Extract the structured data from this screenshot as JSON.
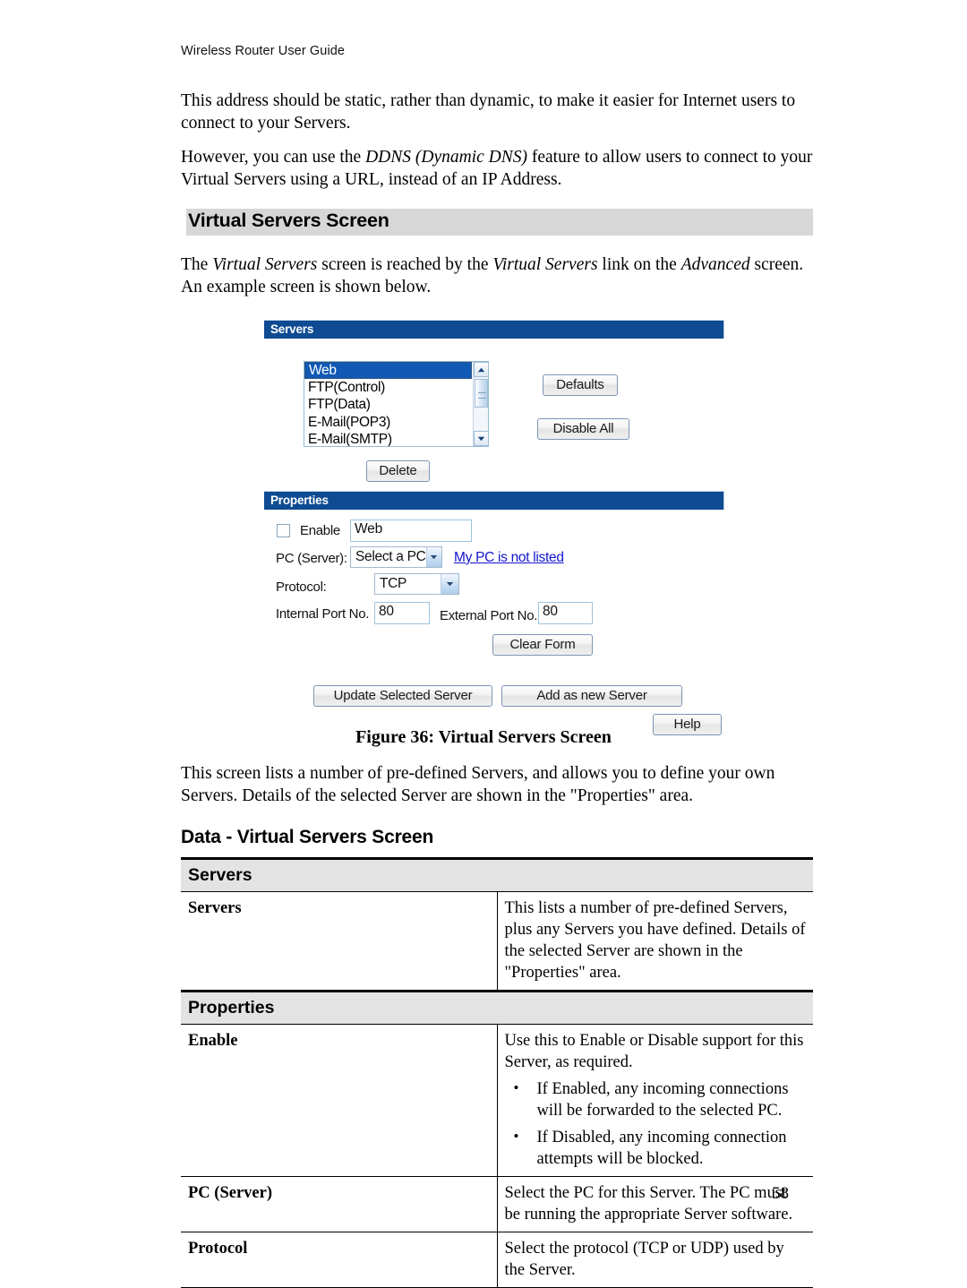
{
  "document": {
    "running_header": "Wireless Router User Guide",
    "page_number": "58"
  },
  "intro": {
    "para1": "This address should be static, rather than dynamic, to make it easier for Internet users to connect to your Servers.",
    "para2_a": "However, you can use the ",
    "para2_em": "DDNS (Dynamic DNS)",
    "para2_b": " feature to allow users to connect to your Virtual Servers using a URL, instead of an IP Address."
  },
  "section_heading": "Virtual Servers Screen",
  "section_intro": {
    "a": "The ",
    "em1": "Virtual Servers",
    "b": " screen is reached by the ",
    "em2": "Virtual Servers",
    "c": " link on the ",
    "em3": "Advanced",
    "d": " screen. An example screen is shown below."
  },
  "figure": {
    "servers_bar": "Servers",
    "server_list": [
      "Web",
      "FTP(Control)",
      "FTP(Data)",
      "E-Mail(POP3)",
      "E-Mail(SMTP)"
    ],
    "selected_server": "Web",
    "defaults_button": "Defaults",
    "disable_all_button": "Disable All",
    "delete_button": "Delete",
    "properties_bar": "Properties",
    "enable_label": "Enable",
    "enable_value": "Web",
    "pc_server_label": "PC (Server):",
    "pc_server_value": "Select a PC",
    "pc_not_listed_link": "My PC is not listed",
    "protocol_label": "Protocol:",
    "protocol_value": "TCP",
    "internal_port_label": "Internal Port No.",
    "internal_port_value": "80",
    "external_port_label": "External Port No.",
    "external_port_value": "80",
    "clear_form_button": "Clear Form",
    "update_button": "Update Selected Server",
    "add_button": "Add as new Server",
    "help_button": "Help",
    "caption": "Figure 36: Virtual Servers Screen",
    "colors": {
      "title_bar": "#0e4b92",
      "selection": "#1059b5",
      "link": "#1414ce"
    }
  },
  "post_figure_text": "This screen lists a number of pre-defined Servers, and allows you to define your own Servers. Details of the selected Server are shown in the \"Properties\" area.",
  "data_table": {
    "title": "Data - Virtual Servers Screen",
    "sections": [
      {
        "header": "Servers",
        "rows": [
          {
            "key": "Servers",
            "value": "This lists a number of pre-defined Servers, plus any Servers you have defined. Details of the selected Server are shown in the \"Properties\" area.",
            "bullets": []
          }
        ]
      },
      {
        "header": "Properties",
        "rows": [
          {
            "key": "Enable",
            "value": "Use this to Enable or Disable support for this Server, as required.",
            "bullets": [
              "If Enabled, any incoming connections will be forwarded to the selected PC.",
              "If Disabled, any incoming connection attempts will be blocked."
            ]
          },
          {
            "key": "PC (Server)",
            "value": "Select the PC for this Server. The PC must be running the appropriate Server software.",
            "bullets": []
          },
          {
            "key": "Protocol",
            "value": "Select the protocol (TCP or UDP) used by the Server.",
            "bullets": []
          }
        ]
      }
    ]
  }
}
